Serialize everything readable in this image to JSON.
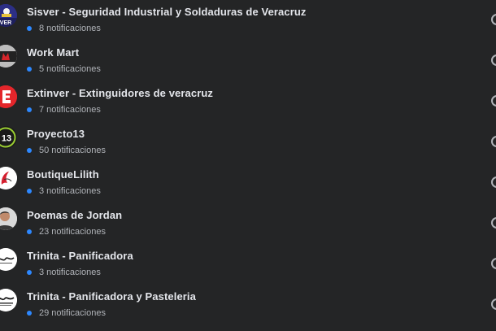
{
  "colors": {
    "background": "#242526",
    "primary_text": "#e4e6eb",
    "secondary_text": "#b0b3b8",
    "unread_dot": "#2d88ff"
  },
  "pages": [
    {
      "name": "Sisver - Seguridad Industrial y Soldaduras de Veracruz",
      "notifications": "8 notificaciones",
      "avatar_icon": "sisver-logo-icon"
    },
    {
      "name": "Work Mart",
      "notifications": "5 notificaciones",
      "avatar_icon": "work-mart-logo-icon"
    },
    {
      "name": "Extinver - Extinguidores de veracruz",
      "notifications": "7 notificaciones",
      "avatar_icon": "extinver-logo-icon"
    },
    {
      "name": "Proyecto13",
      "notifications": "50 notificaciones",
      "avatar_icon": "proyecto13-logo-icon"
    },
    {
      "name": "BoutiqueLilith",
      "notifications": "3 notificaciones",
      "avatar_icon": "boutique-lilith-logo-icon"
    },
    {
      "name": "Poemas de Jordan",
      "notifications": "23 notificaciones",
      "avatar_icon": "person-photo-icon"
    },
    {
      "name": "Trinita - Panificadora",
      "notifications": "3 notificaciones",
      "avatar_icon": "trinita-logo-icon"
    },
    {
      "name": "Trinita - Panificadora y Pasteleria",
      "notifications": "29 notificaciones",
      "avatar_icon": "trinita-logo-icon"
    }
  ]
}
